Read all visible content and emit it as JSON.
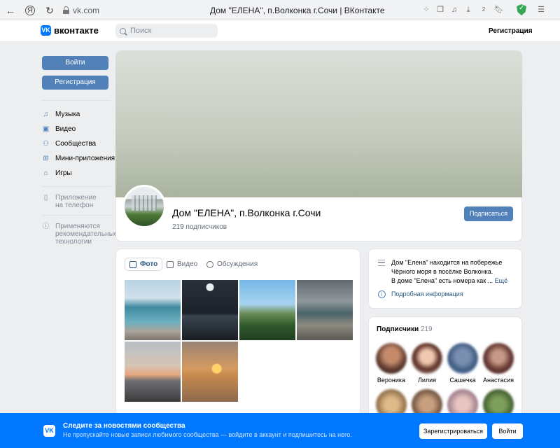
{
  "browser": {
    "url": "vk.com",
    "tab_title": "Дом \"ЕЛЕНА\", п.Волконка г.Сочи | ВКонтакте",
    "tab_badge": "2"
  },
  "header": {
    "logo_text": "вконтакте",
    "search_placeholder": "Поиск",
    "register_link": "Регистрация"
  },
  "sidebar": {
    "login_button": "Войти",
    "register_button": "Регистрация",
    "items": [
      {
        "label": "Музыка",
        "icon": "music-icon"
      },
      {
        "label": "Видео",
        "icon": "video-icon"
      },
      {
        "label": "Сообщества",
        "icon": "communities-icon"
      },
      {
        "label": "Мини-приложения",
        "icon": "mini-apps-icon"
      },
      {
        "label": "Игры",
        "icon": "games-icon"
      }
    ],
    "app_link_line1": "Приложение",
    "app_link_line2": "на телефон",
    "rec_line1": "Применяются",
    "rec_line2": "рекомендательные",
    "rec_line3": "технологии"
  },
  "profile": {
    "name": "Дом \"ЕЛЕНА\", п.Волконка г.Сочи",
    "subscribers": "219 подписчиков",
    "subscribe_button": "Подписаться"
  },
  "media": {
    "tabs": [
      "Фото",
      "Видео",
      "Обсуждения"
    ]
  },
  "info": {
    "line1": "Дом \"Елена\" находится на побережье",
    "line2": "Чёрного моря в посёлке Волконка.",
    "line3": "В доме \"Елена\" есть номера как ...",
    "more": "Ещё",
    "details_link": "Подробная информация"
  },
  "subscribers_block": {
    "title": "Подписчики",
    "count": "219",
    "names": [
      "Вероника",
      "Лилия",
      "Сашечка",
      "Анастасия"
    ]
  },
  "banner": {
    "title": "Следите за новостями сообщества",
    "text": "Не пропускайте новые записи любимого сообщества — войдите в аккаунт и подпишитесь на него.",
    "register_button": "Зарегистрироваться",
    "login_button": "Войти"
  }
}
